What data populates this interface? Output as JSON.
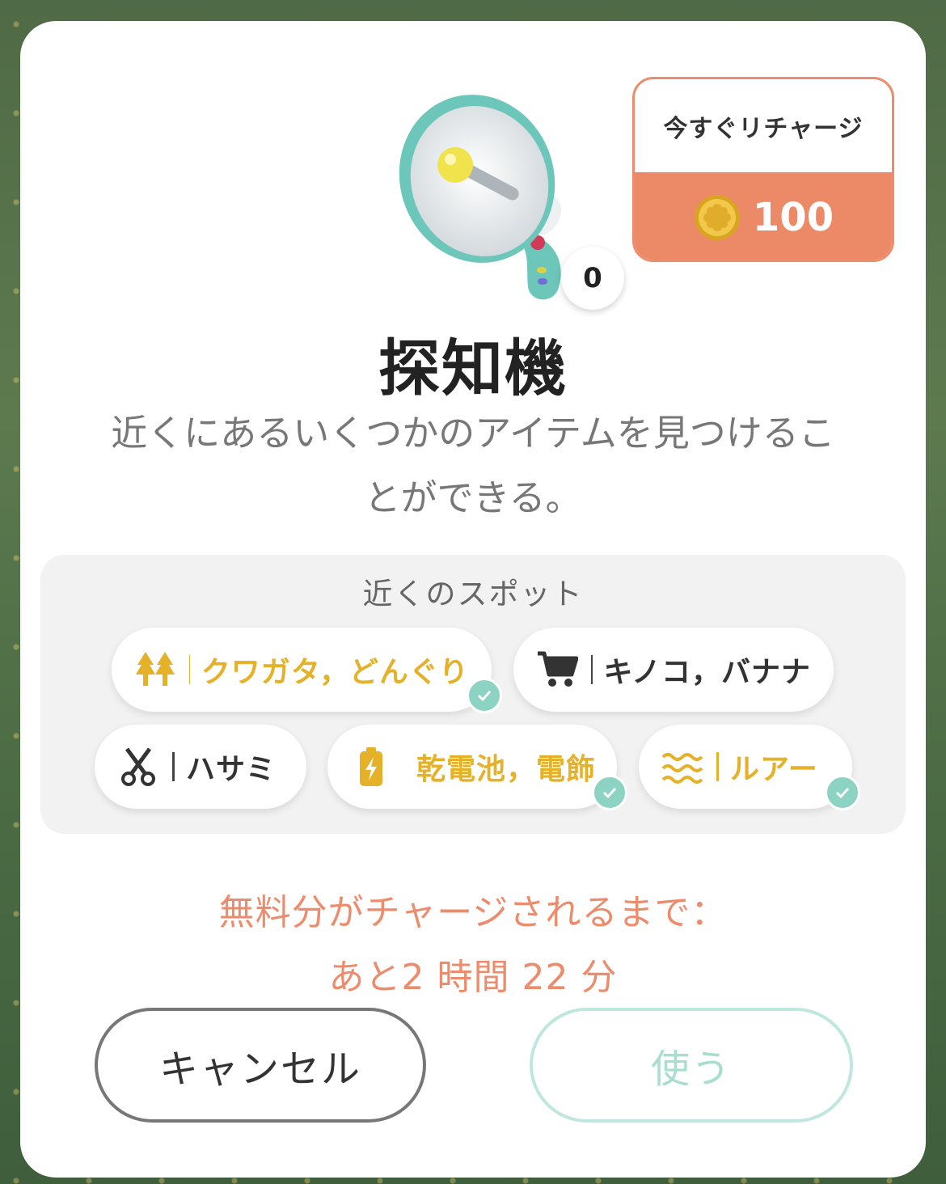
{
  "item": {
    "name": "探知機",
    "count": "0",
    "description_line1": "近くにあるいくつかのアイテムを見つけるこ",
    "description_line2": "とができる。",
    "image_icon": "megaphone-detector-icon"
  },
  "recharge": {
    "label": "今すぐリチャージ",
    "cost": "100",
    "currency_icon": "gold-coin-icon"
  },
  "spots": {
    "heading": "近くのスポット",
    "chips": [
      {
        "icon": "trees-icon",
        "label": "クワガタ，どんぐり",
        "highlighted": true,
        "checked": true
      },
      {
        "icon": "cart-icon",
        "label": "キノコ，バナナ",
        "highlighted": false,
        "checked": false
      },
      {
        "icon": "scissors-icon",
        "label": "ハサミ",
        "highlighted": false,
        "checked": false
      },
      {
        "icon": "battery-icon",
        "label": "乾電池，電飾",
        "highlighted": true,
        "checked": true
      },
      {
        "icon": "waves-icon",
        "label": "ルアー",
        "highlighted": true,
        "checked": true
      }
    ]
  },
  "timer": {
    "line1": "無料分がチャージされるまで：",
    "line2": "あと2 時間 22 分"
  },
  "buttons": {
    "cancel_label": "キャンセル",
    "use_label": "使う"
  },
  "colors": {
    "accent_orange": "#ec8966",
    "highlight_yellow": "#e5b129",
    "check_teal": "#8dd3c4",
    "use_disabled_teal": "#a9ddd0"
  }
}
